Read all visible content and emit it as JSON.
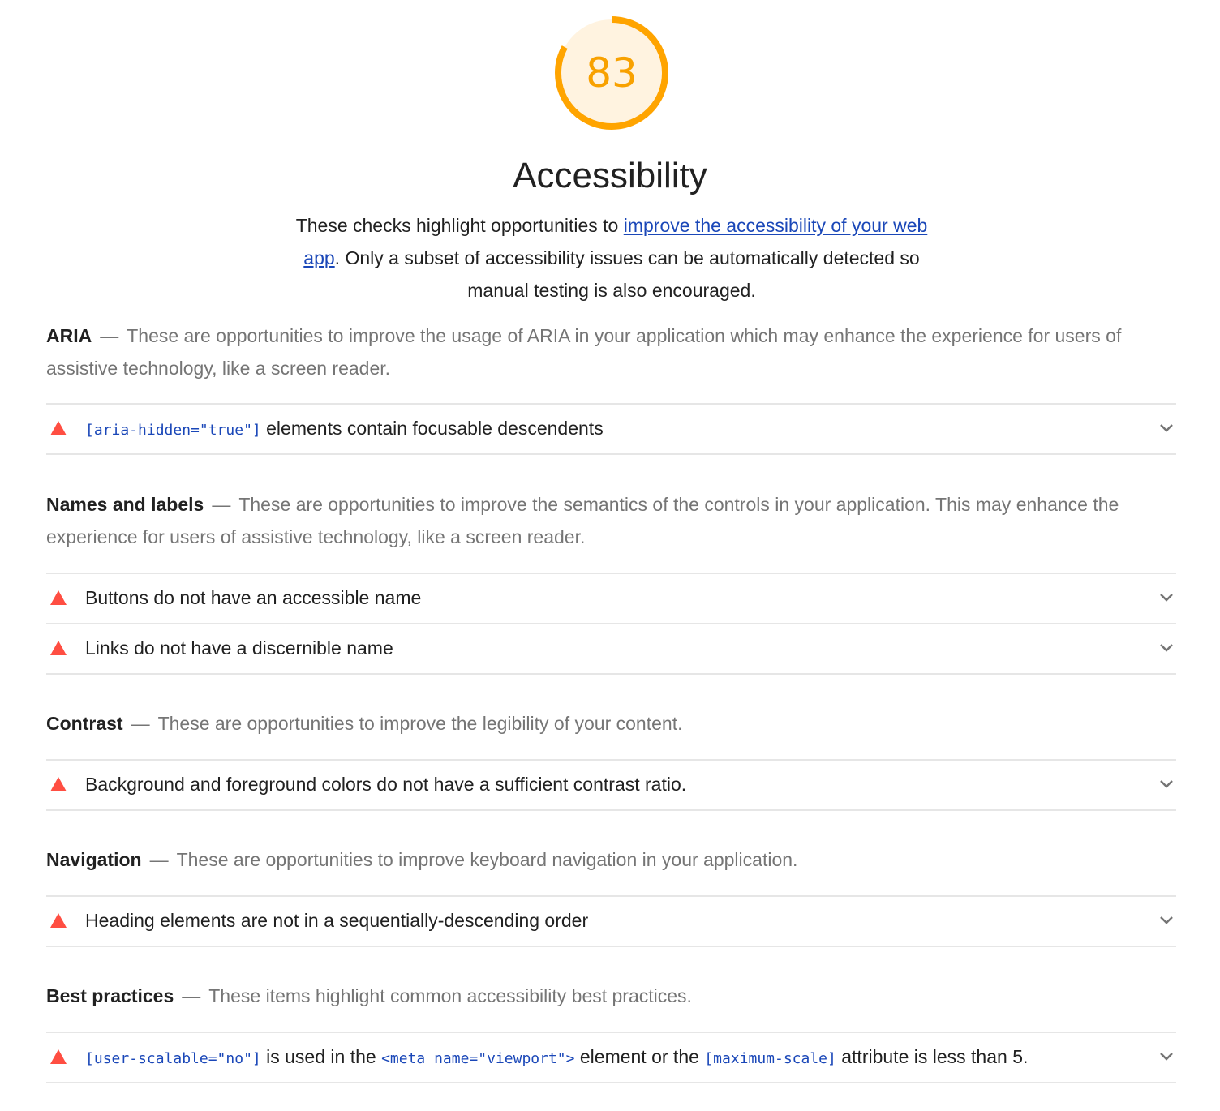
{
  "score": {
    "value": "83",
    "fraction": 0.83,
    "ring_color": "#ffa400",
    "fill_color": "#fff3e0",
    "text_color": "#f8a100"
  },
  "category": {
    "title": "Accessibility",
    "description_before": "These checks highlight opportunities to ",
    "description_link": "improve the accessibility of your web app",
    "description_after": ". Only a subset of accessibility issues can be automatically detected so manual testing is also encouraged."
  },
  "groups": {
    "aria": {
      "title": "ARIA",
      "description": "These are opportunities to improve the usage of ARIA in your application which may enhance the experience for users of assistive technology, like a screen reader."
    },
    "names": {
      "title": "Names and labels",
      "description": "These are opportunities to improve the semantics of the controls in your application. This may enhance the experience for users of assistive technology, like a screen reader."
    },
    "contrast": {
      "title": "Contrast",
      "description": "These are opportunities to improve the legibility of your content."
    },
    "navigation": {
      "title": "Navigation",
      "description": "These are opportunities to improve keyboard navigation in your application."
    },
    "best_practices": {
      "title": "Best practices",
      "description": "These items highlight common accessibility best practices."
    }
  },
  "audits": {
    "aria_hidden": {
      "code": "[aria-hidden=\"true\"]",
      "text": " elements contain focusable descendents"
    },
    "button_name": {
      "text": "Buttons do not have an accessible name"
    },
    "link_name": {
      "text": "Links do not have a discernible name"
    },
    "color_contrast": {
      "text": "Background and foreground colors do not have a sufficient contrast ratio."
    },
    "heading_order": {
      "text": "Heading elements are not in a sequentially-descending order"
    },
    "meta_viewport": {
      "code1": "[user-scalable=\"no\"]",
      "text1": " is used in the ",
      "code2": "<meta name=\"viewport\">",
      "text2": " element or the ",
      "code3": "[maximum-scale]",
      "text3": " attribute is less than 5."
    }
  },
  "icons": {
    "fail": "fail-triangle-icon",
    "expand": "chevron-down-icon"
  },
  "colors": {
    "fail": "#ff4e42",
    "link": "#1a47b8",
    "muted": "#757575"
  }
}
